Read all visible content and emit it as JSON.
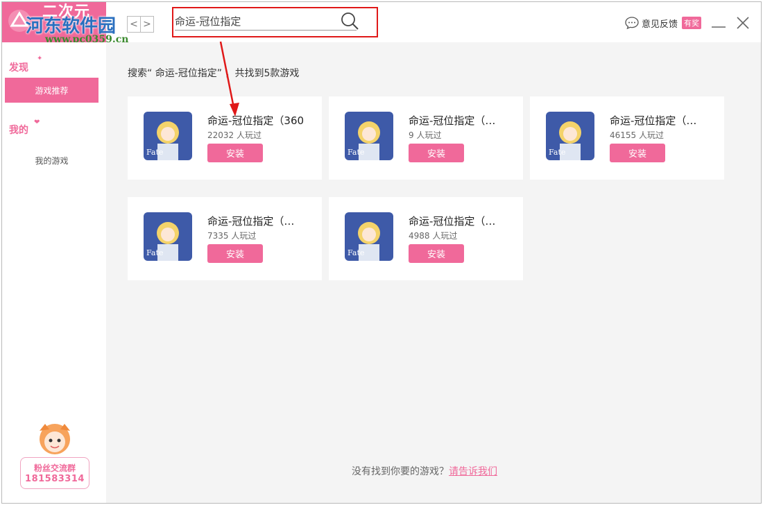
{
  "header": {
    "logo_text": "二次元",
    "watermark": "河东软件园",
    "watermark_url": "www.pc0359.cn",
    "nav_back": "<",
    "nav_forward": ">",
    "search_value": "命运-冠位指定",
    "feedback_label": "意见反馈",
    "feedback_badge": "有奖"
  },
  "sidebar": {
    "discover_label": "发现",
    "active_item": "游戏推荐",
    "mine_label": "我的",
    "my_games": "我的游戏",
    "fan_group_title": "粉丝交流群",
    "fan_group_number": "181583314"
  },
  "main": {
    "result_summary": "搜索“ 命运-冠位指定” ，共找到5款游戏",
    "cards": [
      {
        "title": "命运-冠位指定（360",
        "plays": "22032 人玩过",
        "install": "安装"
      },
      {
        "title": "命运-冠位指定（…",
        "plays": "9 人玩过",
        "install": "安装"
      },
      {
        "title": "命运-冠位指定（…",
        "plays": "46155 人玩过",
        "install": "安装"
      },
      {
        "title": "命运-冠位指定（…",
        "plays": "7335 人玩过",
        "install": "安装"
      },
      {
        "title": "命运-冠位指定（…",
        "plays": "4988 人玩过",
        "install": "安装"
      }
    ],
    "footer_text": "没有找到你要的游戏？",
    "footer_link": "请告诉我们"
  },
  "colors": {
    "accent": "#f0699a",
    "highlight": "#e01818",
    "background": "#f4f4f4"
  },
  "icons": [
    "logo-icon",
    "back-icon",
    "forward-icon",
    "search-icon",
    "feedback-icon",
    "minimize-icon",
    "close-icon",
    "mascot-icon",
    "game-thumbnail"
  ]
}
